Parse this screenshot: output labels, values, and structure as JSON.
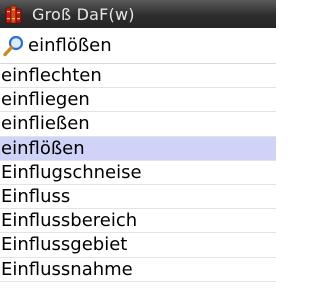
{
  "app": {
    "title": "Groß DaF(w)",
    "icon": "books-icon"
  },
  "search": {
    "icon": "magnifier-icon",
    "value": "einflößen"
  },
  "results": {
    "selected_index": 3,
    "items": [
      "einflechten",
      "einfliegen",
      "einfließen",
      "einflößen",
      "Einflugschneise",
      "Einfluss",
      "Einflussbereich",
      "Einflussgebiet",
      "Einflussnahme"
    ]
  },
  "colors": {
    "titlebar": "#2d2d2d",
    "selected_row": "#cfd3f7",
    "divider": "#e3e3e3"
  }
}
